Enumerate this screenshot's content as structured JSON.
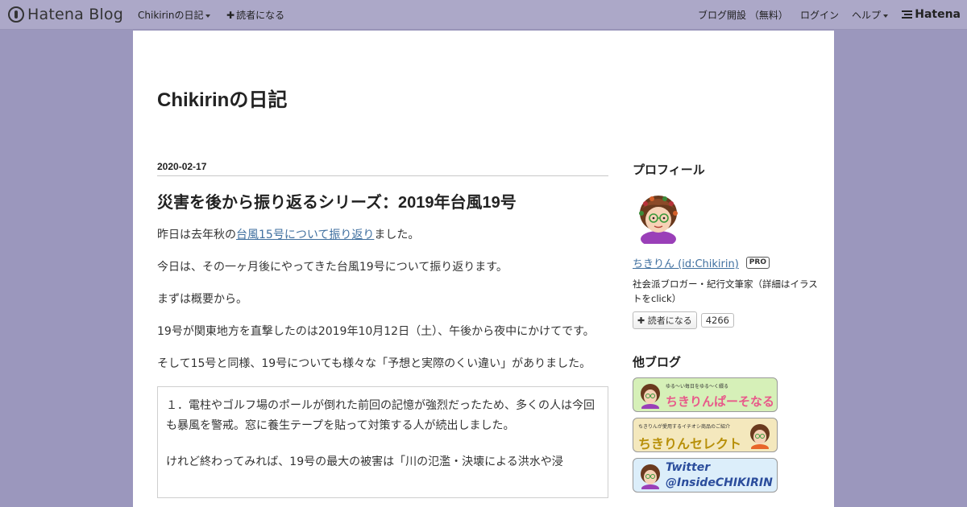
{
  "global_header": {
    "logo_text": "Hatena Blog",
    "blog_menu": "Chikirinの日記",
    "subscribe": "読者になる",
    "start_blog": "ブログ開設 （無料）",
    "login": "ログイン",
    "help": "ヘルプ",
    "hatena": "Hatena"
  },
  "blog": {
    "title": "Chikirinの日記"
  },
  "entry": {
    "date": "2020-02-17",
    "title": "災害を後から振り返るシリーズ：2019年台風19号",
    "p1_before": "昨日は去年秋の",
    "p1_link": "台風15号について振り返り",
    "p1_after": "ました。",
    "p2": "今日は、その一ヶ月後にやってきた台風19号について振り返ります。",
    "p3": "まずは概要から。",
    "p4": "19号が関東地方を直撃したのは2019年10月12日（土）、午後から夜中にかけてです。",
    "p5": "そして15号と同様、19号についても様々な「予想と実際のくい違い」がありました。",
    "quote_p1": "１．電柱やゴルフ場のポールが倒れた前回の記憶が強烈だったため、多くの人は今回も暴風を警戒。窓に養生テープを貼って対策する人が続出しました。",
    "quote_p2": "けれど終わってみれば、19号の最大の被害は「川の氾濫・決壊による洪水や浸"
  },
  "sidebar": {
    "profile_title": "プロフィール",
    "profile_name": "ちきりん (id:Chikirin)",
    "pro_badge": "PRO",
    "profile_desc": "社会派ブロガー・紀行文筆家（詳細はイラストをclick）",
    "reader_button": "読者になる",
    "reader_count": "4266",
    "other_blogs_title": "他ブログ",
    "banners": [
      {
        "small": "ゆる〜い毎日をゆる〜く綴る",
        "big": "ちきりんぱーそなる"
      },
      {
        "small": "ちきりんが愛用するイチオシ商品のご紹介",
        "big": "ちきりんセレクト"
      },
      {
        "small": "",
        "big": "Twitter @InsideCHIKIRIN"
      }
    ]
  },
  "colors": {
    "page_bg": "#9b97bd",
    "header_bg": "#aca8c8",
    "link": "#3f6f9f",
    "banner1_text": "#e85a8a",
    "banner2_text": "#b8900a",
    "banner3_text": "#2b4d9c"
  }
}
